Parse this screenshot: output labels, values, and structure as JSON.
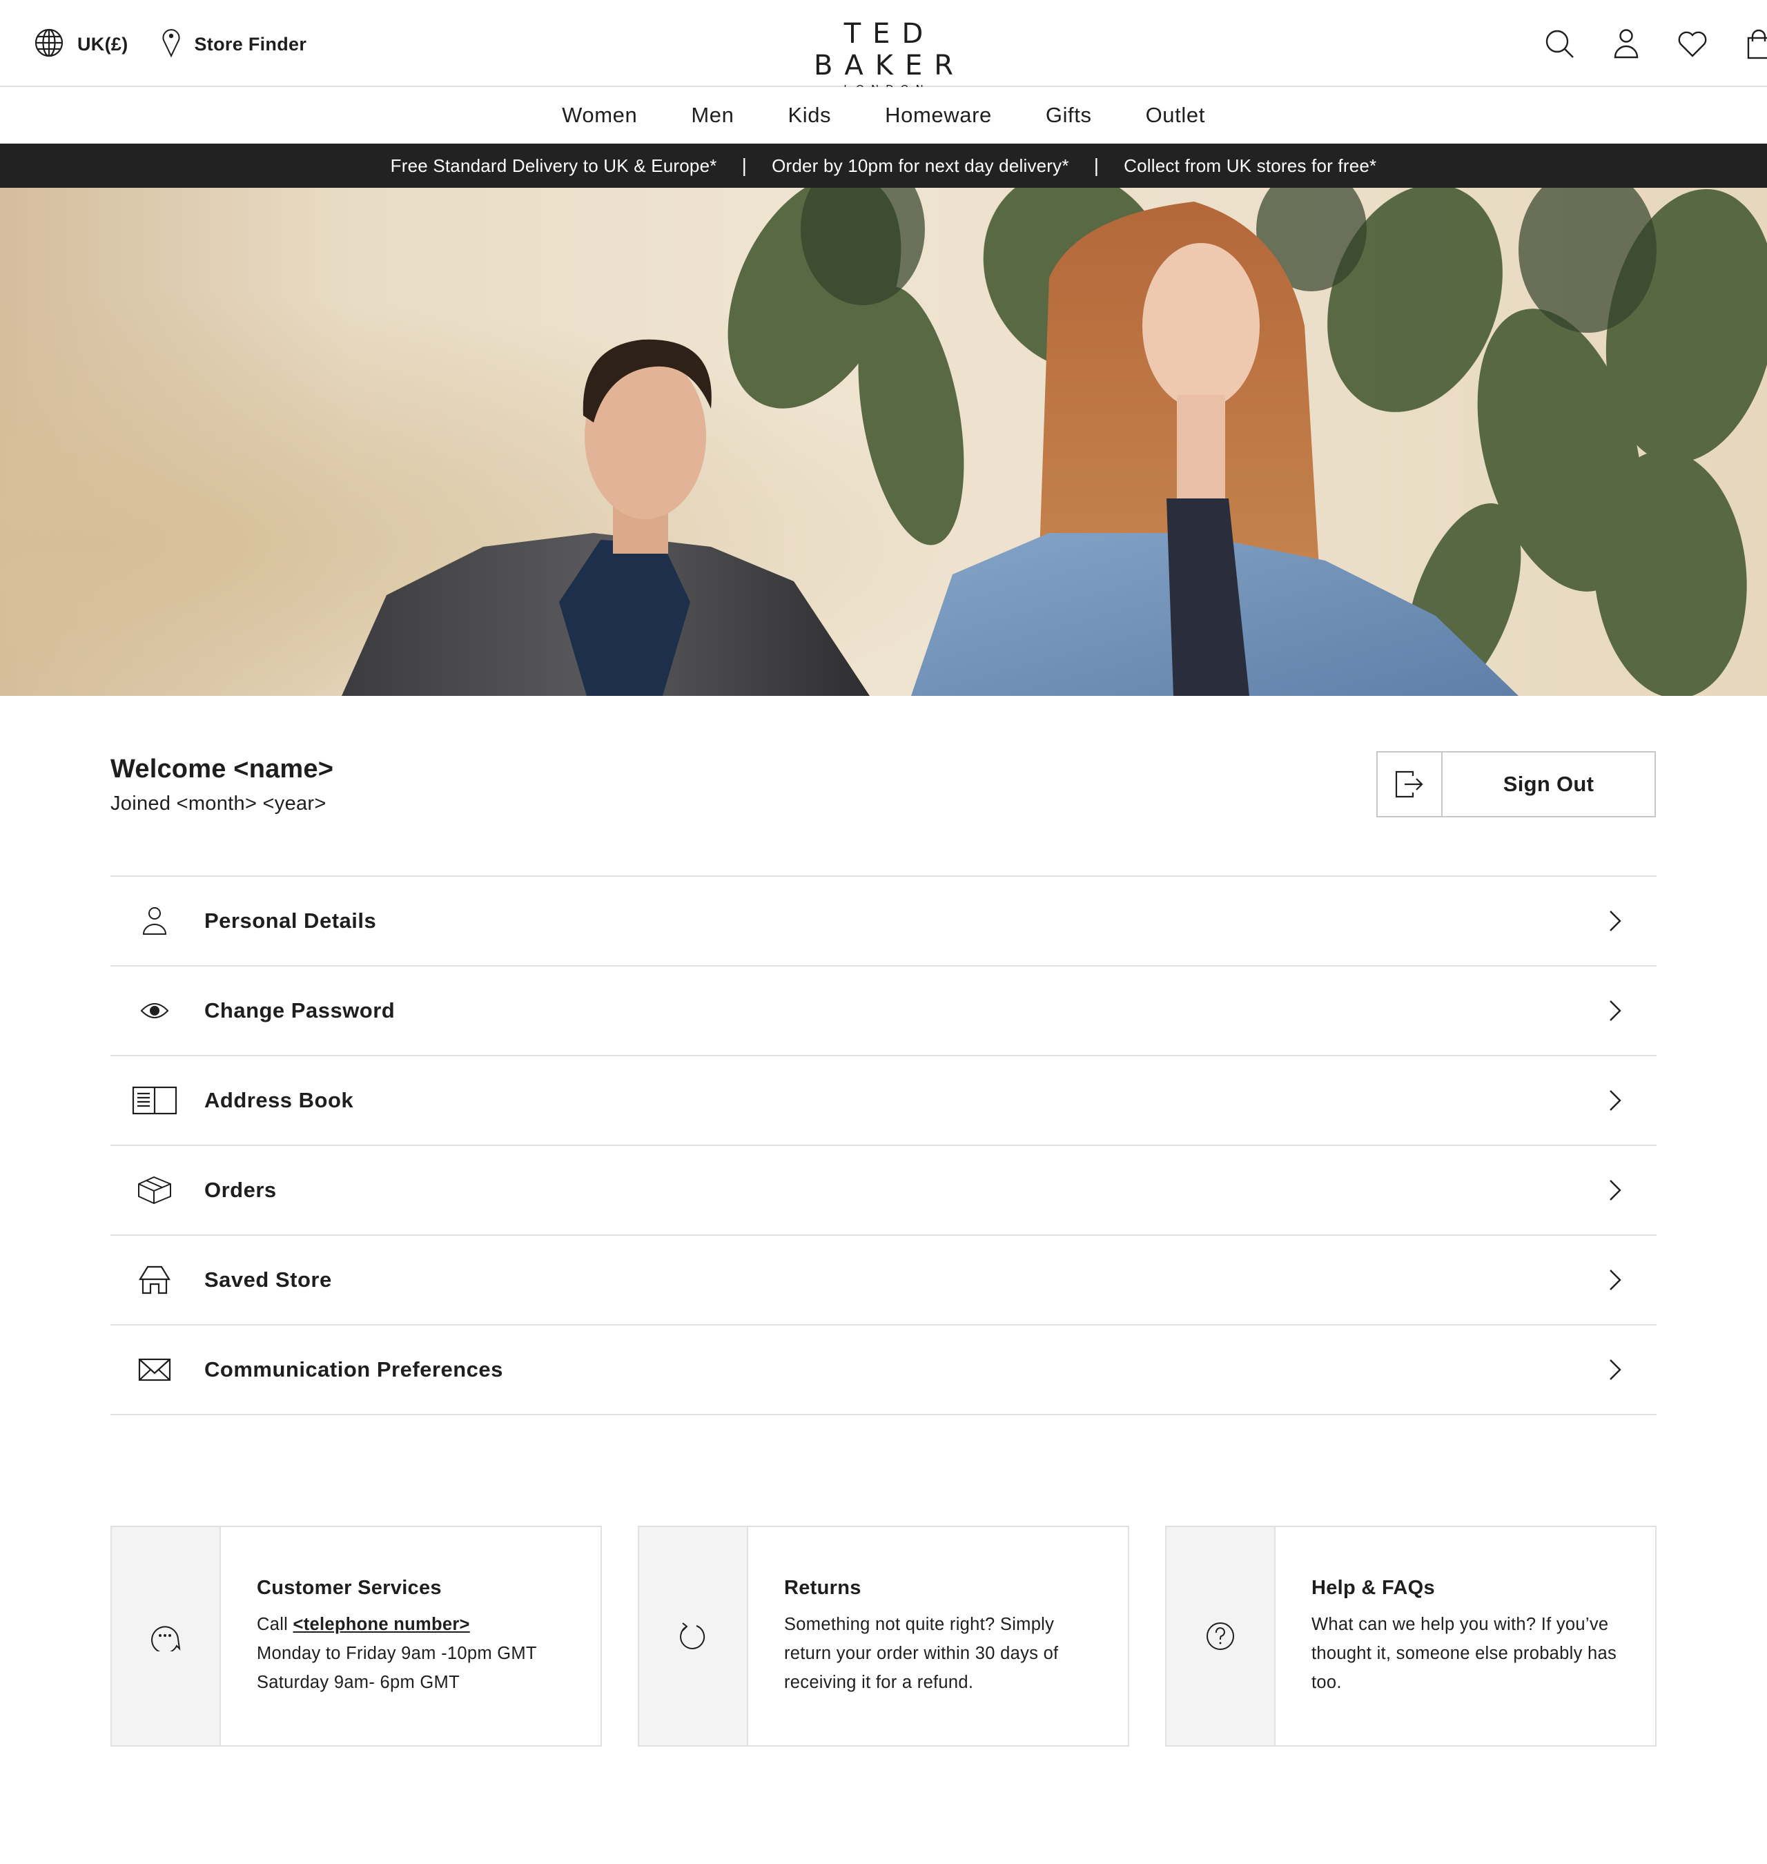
{
  "header": {
    "region_label": "UK(£)",
    "store_finder_label": "Store Finder",
    "logo_main": "TED BAKER",
    "logo_sub": "LONDON",
    "icons": [
      "search-icon",
      "account-icon",
      "wishlist-heart-icon",
      "shopping-bag-icon"
    ]
  },
  "nav": {
    "items": [
      "Women",
      "Men",
      "Kids",
      "Homeware",
      "Gifts",
      "Outlet"
    ]
  },
  "promo": {
    "messages": [
      "Free Standard Delivery to UK & Europe*",
      "Order by 10pm for next day delivery*",
      "Collect from UK stores for free*"
    ],
    "separator": "|"
  },
  "hero": {
    "alt": "Male and female models in autumn outerwear in front of monstera plants"
  },
  "account": {
    "welcome": "Welcome <name>",
    "joined": "Joined <month> <year>",
    "sign_out_label": "Sign Out",
    "menu": [
      {
        "label": "Personal Details",
        "icon": "person-icon"
      },
      {
        "label": "Change Password",
        "icon": "eye-icon"
      },
      {
        "label": "Address Book",
        "icon": "address-book-icon"
      },
      {
        "label": "Orders",
        "icon": "box-icon"
      },
      {
        "label": "Saved Store",
        "icon": "store-icon"
      },
      {
        "label": "Communication Preferences",
        "icon": "envelope-icon"
      }
    ]
  },
  "info_cards": [
    {
      "title": "Customer Services",
      "call_prefix": "Call",
      "phone_link": "<telephone number>",
      "line2": "Monday to Friday 9am -10pm GMT",
      "line3": "Saturday 9am- 6pm GMT",
      "icon": "chat-bubble-icon"
    },
    {
      "title": "Returns",
      "text": "Something not quite right? Simply return your order within 30 days of receiving it for a refund.",
      "icon": "return-arrow-icon"
    },
    {
      "title": "Help & FAQs",
      "text": "What can we help you with? If you’ve thought it, someone else probably has too.",
      "icon": "help-question-icon"
    }
  ]
}
